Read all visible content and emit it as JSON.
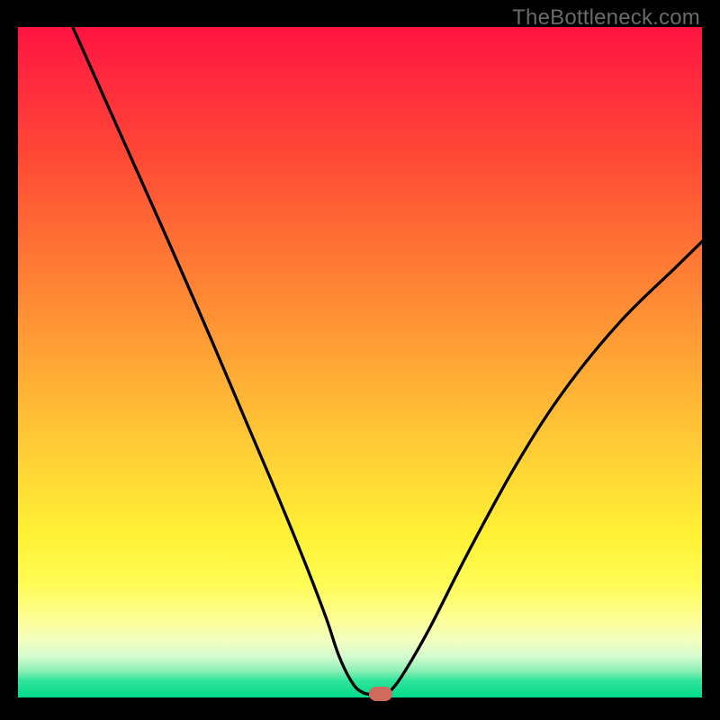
{
  "watermark": "TheBottleneck.com",
  "chart_data": {
    "type": "line",
    "title": "",
    "xlabel": "",
    "ylabel": "",
    "xlim": [
      0,
      100
    ],
    "ylim": [
      0,
      100
    ],
    "grid": false,
    "legend": false,
    "series": [
      {
        "name": "left-branch",
        "x": [
          8,
          15,
          22,
          28,
          33,
          38,
          42,
          45,
          47,
          49,
          50.5,
          51.5
        ],
        "y": [
          100,
          84,
          68,
          54,
          42,
          30,
          20,
          12,
          6,
          2,
          0.7,
          0.5
        ]
      },
      {
        "name": "right-branch",
        "x": [
          54,
          56,
          60,
          66,
          73,
          80,
          88,
          96,
          100
        ],
        "y": [
          0.5,
          3,
          10,
          22,
          35,
          46,
          56,
          64,
          68
        ]
      }
    ],
    "gradient_colors": {
      "top": "#ff1440",
      "mid_upper": "#ff8e34",
      "mid": "#fff235",
      "bottom": "#00db8c"
    },
    "node": {
      "x": 53,
      "y": 0.5,
      "color": "#cf6a5d"
    }
  }
}
